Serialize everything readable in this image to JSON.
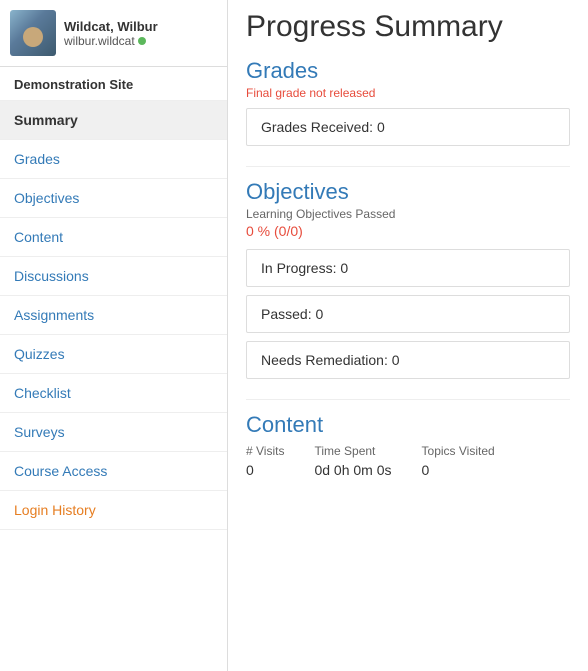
{
  "user": {
    "name": "Wildcat, Wilbur",
    "login": "wilbur.wildcat",
    "online": true
  },
  "sidebar": {
    "site_label": "Demonstration Site",
    "items": [
      {
        "id": "summary",
        "label": "Summary",
        "active": true,
        "style": "active"
      },
      {
        "id": "grades",
        "label": "Grades",
        "style": "normal"
      },
      {
        "id": "objectives",
        "label": "Objectives",
        "style": "normal"
      },
      {
        "id": "content",
        "label": "Content",
        "style": "normal"
      },
      {
        "id": "discussions",
        "label": "Discussions",
        "style": "normal"
      },
      {
        "id": "assignments",
        "label": "Assignments",
        "style": "normal"
      },
      {
        "id": "quizzes",
        "label": "Quizzes",
        "style": "normal"
      },
      {
        "id": "checklist",
        "label": "Checklist",
        "style": "normal"
      },
      {
        "id": "surveys",
        "label": "Surveys",
        "style": "normal"
      },
      {
        "id": "course-access",
        "label": "Course Access",
        "style": "normal"
      },
      {
        "id": "login-history",
        "label": "Login History",
        "style": "orange"
      }
    ]
  },
  "main": {
    "title": "Progress Summary",
    "grades": {
      "section_title": "Grades",
      "subtitle": "Final grade not released",
      "grades_received_label": "Grades Received: 0"
    },
    "objectives": {
      "section_title": "Objectives",
      "subtitle_label": "Learning Objectives Passed",
      "percent": "0 %",
      "fraction": "(0/0)",
      "in_progress_label": "In Progress: 0",
      "passed_label": "Passed: 0",
      "needs_remediation_label": "Needs Remediation: 0"
    },
    "content": {
      "section_title": "Content",
      "visits_label": "# Visits",
      "time_spent_label": "Time Spent",
      "topics_visited_label": "Topics Visited",
      "visits_value": "0",
      "time_spent_value": "0d 0h 0m 0s",
      "topics_visited_value": "0"
    }
  }
}
